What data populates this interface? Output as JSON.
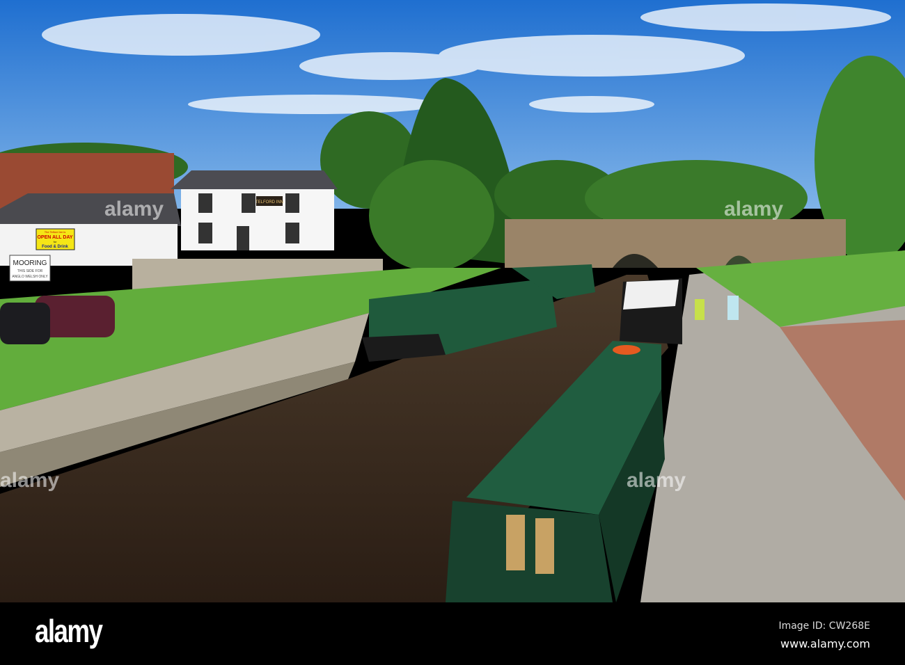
{
  "signs": {
    "inn_name": "TELFORD INN",
    "banner_top": "The Telford Inn is",
    "banner_main": "OPEN ALL DAY",
    "banner_for": "for",
    "banner_bottom": "Food & Drink",
    "mooring_title": "MOORING",
    "mooring_line1": "THIS SIDE FOR",
    "mooring_line2": "ANGLO WELSH ONLY"
  },
  "watermark": {
    "logo": "alamy",
    "image_id": "Image ID: CW268E",
    "url": "www.alamy.com"
  },
  "colors": {
    "sky": "#2f7fd8",
    "grass": "#5aa83a",
    "boat": "#1f5a3c",
    "water": "#3a2a1c"
  }
}
